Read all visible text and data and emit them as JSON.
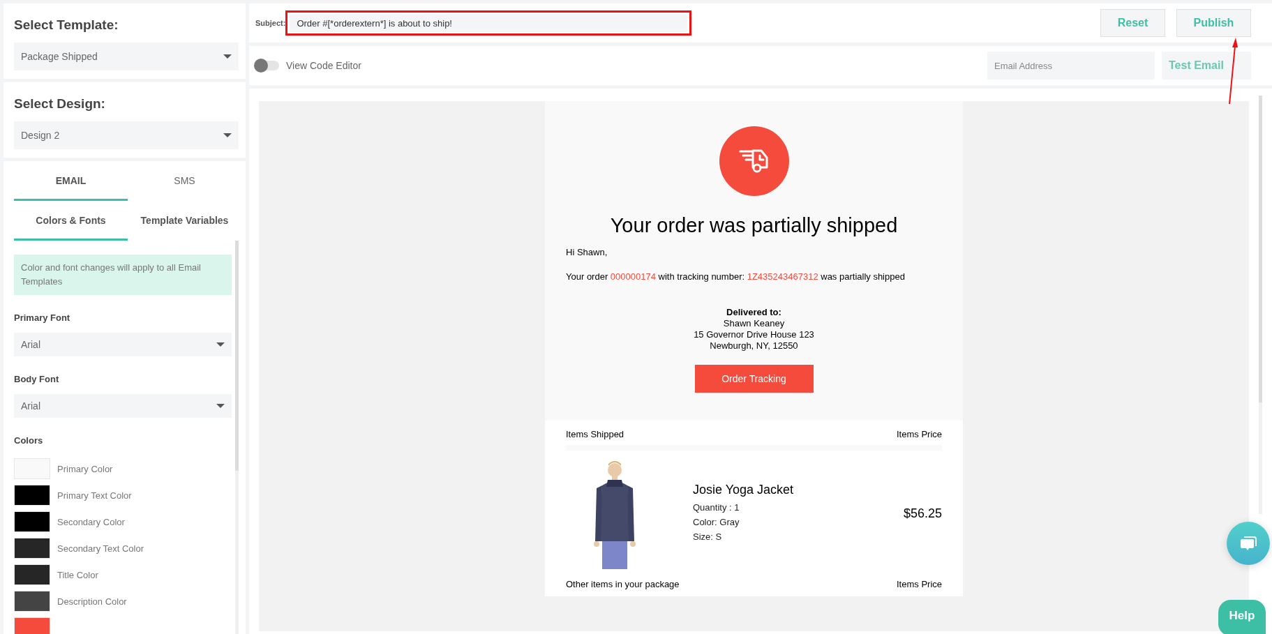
{
  "sidebar": {
    "template": {
      "heading": "Select Template:",
      "value": "Package Shipped"
    },
    "design": {
      "heading": "Select Design:",
      "value": "Design 2"
    },
    "channel_tabs": [
      {
        "label": "EMAIL",
        "selected": true
      },
      {
        "label": "SMS",
        "selected": false
      }
    ],
    "section_tabs": [
      {
        "label": "Colors & Fonts",
        "selected": true
      },
      {
        "label": "Template Variables",
        "selected": false
      }
    ],
    "notice": "Color and font changes will apply to all Email Templates",
    "primary_font": {
      "label": "Primary Font",
      "value": "Arial"
    },
    "body_font": {
      "label": "Body Font",
      "value": "Arial"
    },
    "colors_heading": "Colors",
    "colors": [
      {
        "label": "Primary Color",
        "color": "#f9f9f9"
      },
      {
        "label": "Primary Text Color",
        "color": "#000000"
      },
      {
        "label": "Secondary Color",
        "color": "#000000"
      },
      {
        "label": "Secondary Text Color",
        "color": "#262626"
      },
      {
        "label": "Title Color",
        "color": "#262626"
      },
      {
        "label": "Description Color",
        "color": "#444444"
      },
      {
        "color": "#f44b3c"
      }
    ]
  },
  "toolbar": {
    "subject_label": "Subject:",
    "subject": "Order #[*orderextern*] is about to ship!",
    "reset": "Reset",
    "publish": "Publish"
  },
  "editor_bar": {
    "code_editor": {
      "label": "View Code Editor",
      "on": false
    },
    "email_placeholder": "Email Address",
    "test_button": "Test Email"
  },
  "email": {
    "title": "Your order was partially shipped",
    "greeting": "Hi Shawn,",
    "message": [
      {
        "text": "Your order ",
        "highlight": false
      },
      {
        "text": "000000174",
        "highlight": true
      },
      {
        "text": " with tracking number: ",
        "highlight": false
      },
      {
        "text": "1Z435243467312",
        "highlight": true
      },
      {
        "text": " was partially shipped",
        "highlight": false
      }
    ],
    "delivered_heading": "Delivered to:",
    "address": [
      "Shawn Keaney",
      "15 Governor Drive House 123",
      "Newburgh, NY, 12550"
    ],
    "tracking_button": "Order Tracking",
    "items_heading": "Items Shipped",
    "price_heading": "Items Price",
    "items": [
      {
        "kind": "picture",
        "name": "Josie Yoga Jacket",
        "details": [
          "Quantity : 1",
          "Color: Gray",
          "Size: S"
        ],
        "price": "$56.25"
      }
    ],
    "other_heading": "Other items in your package",
    "other_price_heading": "Items Price"
  },
  "help_button": "Help"
}
